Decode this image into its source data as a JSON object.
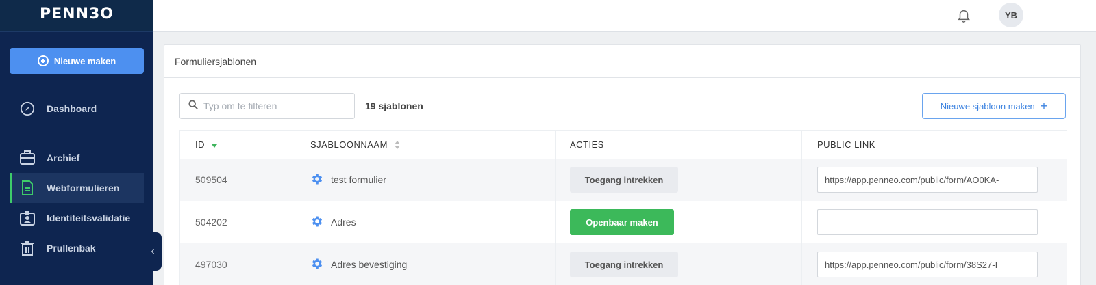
{
  "app": {
    "logo_text": "PENN3O",
    "new_button_label": "Nieuwe maken"
  },
  "sidebar": {
    "items": [
      {
        "label": "Dashboard",
        "icon": "compass-icon",
        "active": false
      },
      {
        "label": "Archief",
        "icon": "briefcase-icon",
        "active": false
      },
      {
        "label": "Webformulieren",
        "icon": "document-icon",
        "active": true
      },
      {
        "label": "Identiteitsvalidatie",
        "icon": "id-badge-icon",
        "active": false
      },
      {
        "label": "Prullenbak",
        "icon": "trash-icon",
        "active": false
      }
    ],
    "collapse_glyph": "‹"
  },
  "header": {
    "avatar_initials": "YB"
  },
  "card": {
    "title": "Formuliersjablonen",
    "filter_placeholder": "Typ om te filteren",
    "count_label": "19 sjablonen",
    "new_template_label": "Nieuwe sjabloon maken"
  },
  "table": {
    "columns": [
      "ID",
      "SJABLOONNAAM",
      "ACTIES",
      "PUBLIC LINK"
    ],
    "rows": [
      {
        "id": "509504",
        "name": "test formulier",
        "action": "Toegang intrekken",
        "action_type": "revoke",
        "link": "https://app.penneo.com/public/form/AO0KA-"
      },
      {
        "id": "504202",
        "name": "Adres",
        "action": "Openbaar maken",
        "action_type": "publish",
        "link": ""
      },
      {
        "id": "497030",
        "name": "Adres bevestiging",
        "action": "Toegang intrekken",
        "action_type": "revoke",
        "link": "https://app.penneo.com/public/form/38S27-I"
      }
    ]
  },
  "colors": {
    "sidebar_bg": "#0e2550",
    "primary_blue": "#4d90f0",
    "active_green": "#3ecb6a",
    "publish_green": "#3cb95a"
  }
}
